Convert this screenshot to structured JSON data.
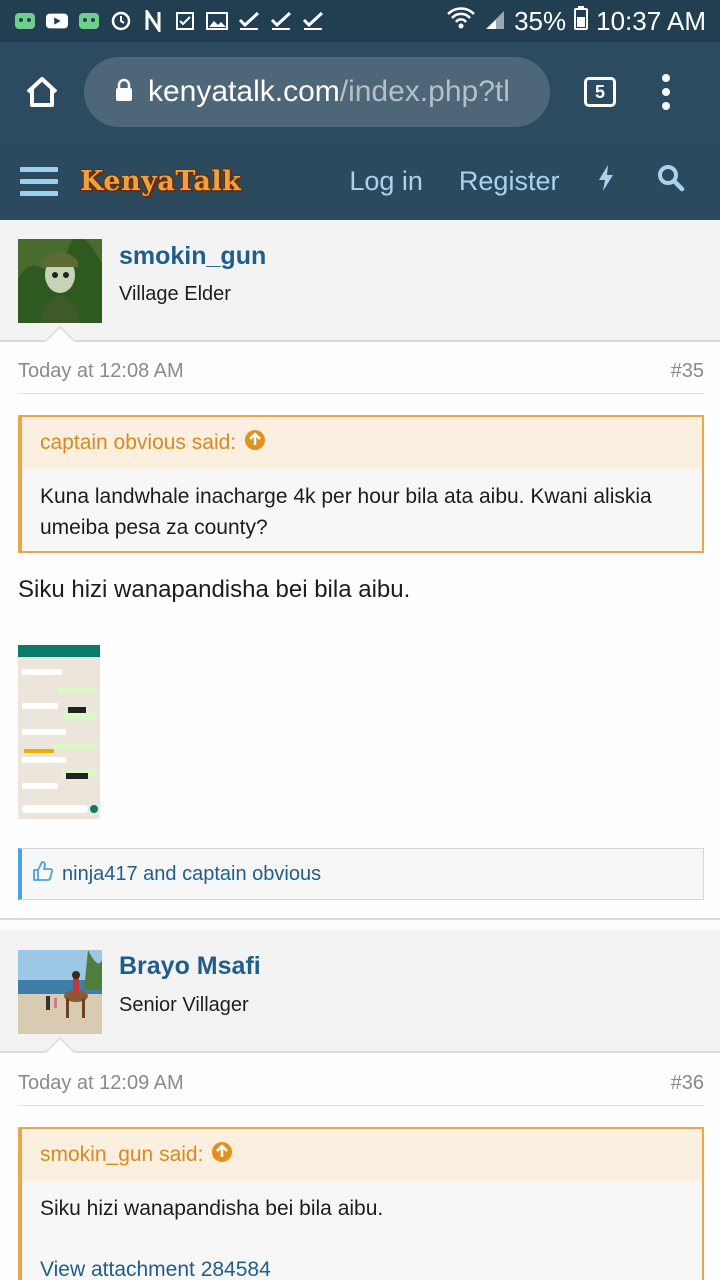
{
  "status_bar": {
    "battery": "35%",
    "time": "10:37 AM",
    "left_icons": [
      "android-icon",
      "youtube-icon",
      "android-icon",
      "sync-icon",
      "n-icon",
      "checkbox-icon",
      "image-icon",
      "check-icon",
      "check-icon",
      "check-icon"
    ]
  },
  "browser": {
    "url_host": "kenyatalk.com",
    "url_path": "/index.php?tl",
    "tab_count": "5"
  },
  "site": {
    "logo": "KenyaTalk",
    "login": "Log in",
    "register": "Register"
  },
  "posts": [
    {
      "username": "smokin_gun",
      "user_title": "Village Elder",
      "time": "Today at 12:08 AM",
      "number": "#35",
      "quote_author": "captain obvious said:",
      "quote_text": "Kuna landwhale inacharge 4k per hour bila ata aibu. Kwani aliskia umeiba pesa za county?",
      "text": "Siku hizi wanapandisha bei bila aibu.",
      "likes": "ninja417 and captain obvious"
    },
    {
      "username": "Brayo Msafi",
      "user_title": "Senior Villager",
      "time": "Today at 12:09 AM",
      "number": "#36",
      "quote_author": "smokin_gun said:",
      "quote_text": "Siku hizi wanapandisha bei bila aibu.",
      "quote_link": "View attachment 284584"
    }
  ],
  "colors": {
    "header_bg": "#2b4a5e",
    "link_blue": "#1f5e8a",
    "quote_orange": "#e7a74a",
    "logo_orange": "#f0a23a"
  }
}
